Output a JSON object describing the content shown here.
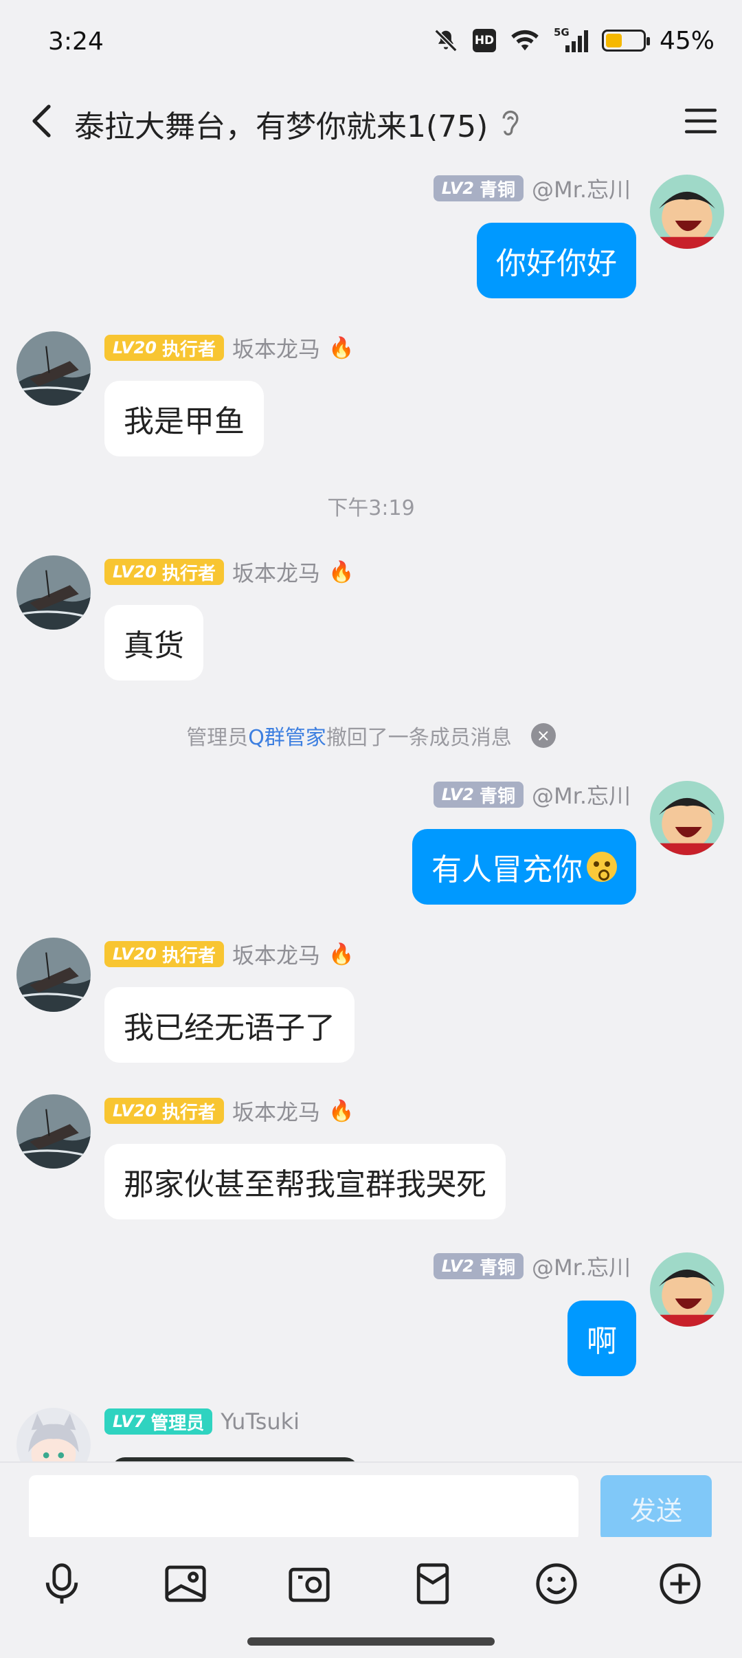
{
  "status_bar": {
    "time": "3:24",
    "battery_percent": "45%",
    "battery_level": 0.45,
    "icons": [
      "mute-bell-icon",
      "hd-icon",
      "wifi-icon",
      "5g-signal-icon",
      "battery-icon"
    ],
    "hd_label": "HD",
    "network_label": "5G"
  },
  "header": {
    "title": "泰拉大舞台，有梦你就来1(75)",
    "icons": [
      "back-arrow-icon",
      "ear-icon",
      "menu-icon"
    ]
  },
  "messages": [
    {
      "side": "out",
      "badge_lv": "LV2",
      "badge_title": "青铜",
      "nick": "@Mr.忘川",
      "text": "你好你好"
    },
    {
      "side": "in",
      "badge_lv": "LV20",
      "badge_title": "执行者",
      "nick": "坂本龙马",
      "flair": "🔥",
      "text": "我是甲鱼"
    },
    {
      "timestamp": "下午3:19"
    },
    {
      "side": "in",
      "badge_lv": "LV20",
      "badge_title": "执行者",
      "nick": "坂本龙马",
      "flair": "🔥",
      "text": "真货"
    },
    {
      "system": {
        "prefix": "管理员",
        "link": "Q群管家",
        "suffix": "撤回了一条成员消息",
        "close_label": "×"
      }
    },
    {
      "side": "out",
      "badge_lv": "LV2",
      "badge_title": "青铜",
      "nick": "@Mr.忘川",
      "text": "有人冒充你"
    },
    {
      "side": "in",
      "badge_lv": "LV20",
      "badge_title": "执行者",
      "nick": "坂本龙马",
      "flair": "🔥",
      "text": "我已经无语子了"
    },
    {
      "side": "in",
      "badge_lv": "LV20",
      "badge_title": "执行者",
      "nick": "坂本龙马",
      "flair": "🔥",
      "text": "那家伙甚至帮我宣群我哭死"
    },
    {
      "side": "out",
      "badge_lv": "LV2",
      "badge_title": "青铜",
      "nick": "@Mr.忘川",
      "text": "啊"
    },
    {
      "side": "in",
      "badge_lv": "LV7",
      "badge_title": "管理员",
      "nick": "YuTsuki",
      "text": ""
    }
  ],
  "input": {
    "placeholder": "",
    "send_label": "发送"
  },
  "toolbar": [
    "microphone-icon",
    "image-icon",
    "camera-icon",
    "red-packet-icon",
    "emoji-icon",
    "plus-icon"
  ]
}
